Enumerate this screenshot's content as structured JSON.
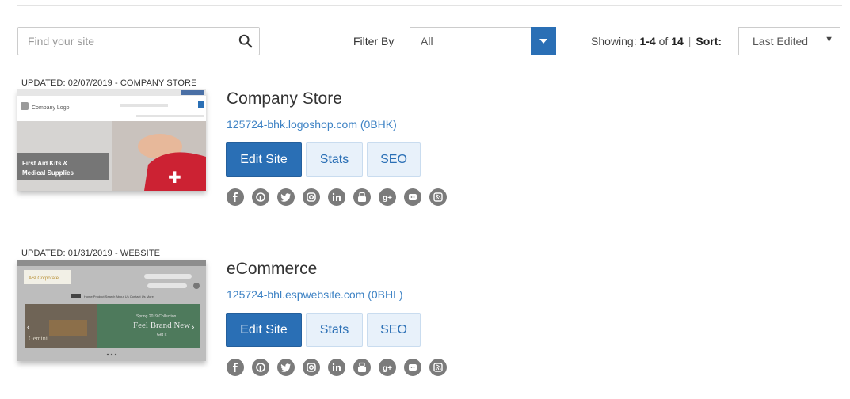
{
  "search": {
    "placeholder": "Find your site"
  },
  "filter": {
    "label": "Filter By",
    "selected": "All"
  },
  "pagination": {
    "prefix": "Showing:",
    "range": "1-4",
    "of": "of",
    "total": "14",
    "sort_label": "Sort:",
    "sort_selected": "Last Edited"
  },
  "sites": [
    {
      "updated": "UPDATED: 02/07/2019 - COMPANY STORE",
      "title": "Company Store",
      "url": "125724-bhk.logoshop.com (0BHK)",
      "thumb": {
        "logo": "Company Logo",
        "headline_1": "First Aid Kits &",
        "headline_2": "Medical Supplies"
      },
      "buttons": {
        "edit": "Edit Site",
        "stats": "Stats",
        "seo": "SEO"
      }
    },
    {
      "updated": "UPDATED: 01/31/2019 - WEBSITE",
      "title": "eCommerce",
      "url": "125724-bhl.espwebsite.com (0BHL)",
      "thumb": {
        "logo": "ASI Corporate",
        "banner_1": "Spring 2019 Collection",
        "banner_2": "Feel Brand New",
        "banner_3": "Get It",
        "side_text": "Gemini",
        "nav": "Home  Product Search  About Us  Contact Us  More"
      },
      "buttons": {
        "edit": "Edit Site",
        "stats": "Stats",
        "seo": "SEO"
      }
    }
  ],
  "social_icons": [
    "facebook-icon",
    "pinterest-icon",
    "twitter-icon",
    "instagram-icon",
    "linkedin-icon",
    "youtube-icon",
    "google-plus-icon",
    "blog-icon",
    "rss-icon"
  ],
  "colors": {
    "primary": "#2a6fb5",
    "link": "#3d82c4",
    "social": "#7b7b7b"
  }
}
